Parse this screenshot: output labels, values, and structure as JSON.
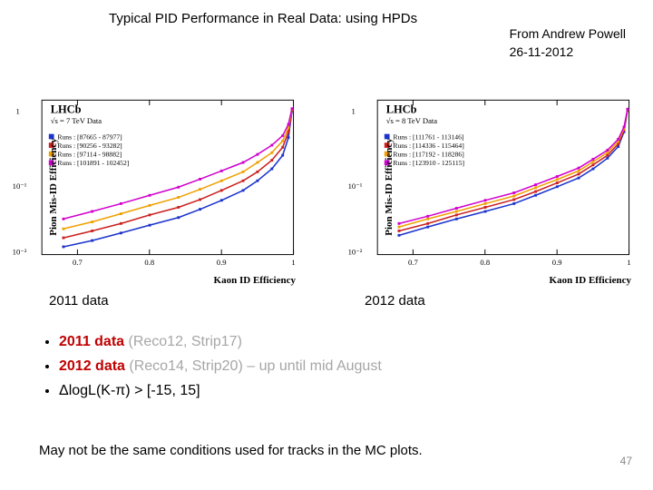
{
  "title": "Typical PID  Performance in Real Data: using HPDs",
  "credit_line1": "From Andrew Powell",
  "credit_line2": "26-11-2012",
  "caption_2011": "2011 data",
  "caption_2012": "2012 data",
  "bullet1_a": "2011 data ",
  "bullet1_b": "(Reco12, Strip17)",
  "bullet2_a": "2012 data ",
  "bullet2_b": "(Reco14, Strip20) – up until mid August",
  "bullet3": "ΔlogL(K-π) > [-15, 15]",
  "footer": "May not be the  same conditions  used for tracks in the MC plots.",
  "page": "47",
  "plot_left": {
    "experiment": "LHCb",
    "sqrt": "√s = 7 TeV  Data",
    "xlabel": "Kaon ID Efficiency",
    "ylabel": "Pion Mis-ID Efficiency",
    "runs": [
      "Runs : [87665 - 87977]",
      "Runs : [90256 - 93282]",
      "Runs : [97114 - 98882]",
      "Runs : [101891 - 102452]"
    ]
  },
  "plot_right": {
    "experiment": "LHCb",
    "sqrt": "√s = 8 TeV  Data",
    "xlabel": "Kaon ID Efficiency",
    "ylabel": "Pion Mis-ID Efficiency",
    "runs": [
      "Runs : [111761 - 113146]",
      "Runs : [114336 - 115464]",
      "Runs : [117192 - 118286]",
      "Runs : [123910 - 125115]"
    ]
  },
  "chart_data": [
    {
      "type": "line",
      "title": "2011 data",
      "xlabel": "Kaon ID Efficiency",
      "ylabel": "Pion Mis-ID Efficiency",
      "xlim": [
        0.65,
        1.0
      ],
      "ylim": [
        0.007,
        1.0
      ],
      "yscale": "log",
      "x": [
        0.68,
        0.72,
        0.76,
        0.8,
        0.84,
        0.87,
        0.9,
        0.93,
        0.95,
        0.97,
        0.985,
        0.993,
        0.998
      ],
      "series": [
        {
          "name": "Runs : [87665 - 87977]",
          "color": "#1b33cc",
          "values": [
            0.009,
            0.011,
            0.014,
            0.018,
            0.023,
            0.03,
            0.04,
            0.055,
            0.075,
            0.11,
            0.17,
            0.3,
            0.7
          ]
        },
        {
          "name": "Runs : [90256 - 93282]",
          "color": "#cc2020",
          "values": [
            0.012,
            0.015,
            0.019,
            0.025,
            0.032,
            0.041,
            0.055,
            0.075,
            0.1,
            0.145,
            0.22,
            0.36,
            0.72
          ]
        },
        {
          "name": "Runs : [97114 - 98882]",
          "color": "#f0a000",
          "values": [
            0.016,
            0.02,
            0.026,
            0.034,
            0.044,
            0.057,
            0.075,
            0.1,
            0.135,
            0.185,
            0.27,
            0.41,
            0.74
          ]
        },
        {
          "name": "Runs : [101891 - 102452]",
          "color": "#d000d0",
          "values": [
            0.022,
            0.028,
            0.036,
            0.047,
            0.061,
            0.079,
            0.103,
            0.135,
            0.175,
            0.235,
            0.32,
            0.46,
            0.76
          ]
        }
      ]
    },
    {
      "type": "line",
      "title": "2012 data",
      "xlabel": "Kaon ID Efficiency",
      "ylabel": "Pion Mis-ID Efficiency",
      "xlim": [
        0.65,
        1.0
      ],
      "ylim": [
        0.007,
        1.0
      ],
      "yscale": "log",
      "x": [
        0.68,
        0.72,
        0.76,
        0.8,
        0.84,
        0.87,
        0.9,
        0.93,
        0.95,
        0.97,
        0.985,
        0.993,
        0.998
      ],
      "series": [
        {
          "name": "Runs : [111761 - 113146]",
          "color": "#1b33cc",
          "values": [
            0.013,
            0.017,
            0.022,
            0.028,
            0.036,
            0.047,
            0.062,
            0.082,
            0.11,
            0.155,
            0.225,
            0.36,
            0.72
          ]
        },
        {
          "name": "Runs : [114336 - 115464]",
          "color": "#cc2020",
          "values": [
            0.015,
            0.019,
            0.025,
            0.032,
            0.041,
            0.053,
            0.07,
            0.093,
            0.125,
            0.17,
            0.245,
            0.38,
            0.73
          ]
        },
        {
          "name": "Runs : [117192 - 118286]",
          "color": "#f0a000",
          "values": [
            0.017,
            0.022,
            0.028,
            0.036,
            0.046,
            0.06,
            0.078,
            0.103,
            0.138,
            0.185,
            0.265,
            0.4,
            0.74
          ]
        },
        {
          "name": "Runs : [123910 - 125115]",
          "color": "#d000d0",
          "values": [
            0.019,
            0.024,
            0.031,
            0.04,
            0.051,
            0.066,
            0.086,
            0.113,
            0.15,
            0.2,
            0.285,
            0.42,
            0.75
          ]
        }
      ]
    }
  ]
}
